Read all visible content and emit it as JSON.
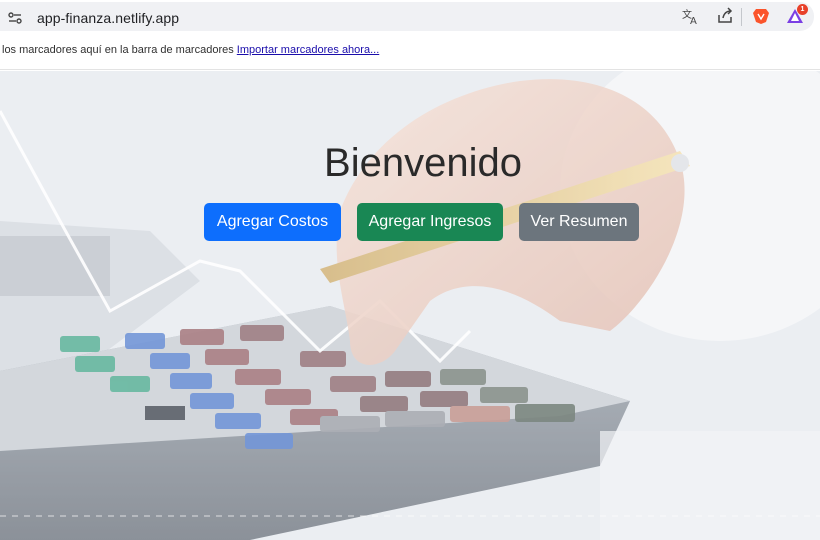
{
  "browser": {
    "url": "app-finanza.netlify.app",
    "rewards_badge": "1",
    "icons": [
      "site-info-icon",
      "translate-icon",
      "share-icon",
      "brave-lion-icon",
      "brave-rewards-icon"
    ]
  },
  "bookmarks_bar": {
    "message": "los marcadores aquí en la barra de marcadores",
    "import_link": "Importar marcadores ahora..."
  },
  "hero": {
    "title": "Bienvenido",
    "buttons": {
      "costos": "Agregar Costos",
      "ingresos": "Agregar Ingresos",
      "resumen": "Ver Resumen"
    }
  },
  "colors": {
    "primary": "#0d6efd",
    "success": "#198754",
    "secondary": "#6c757d",
    "brave": "#fb542b"
  }
}
